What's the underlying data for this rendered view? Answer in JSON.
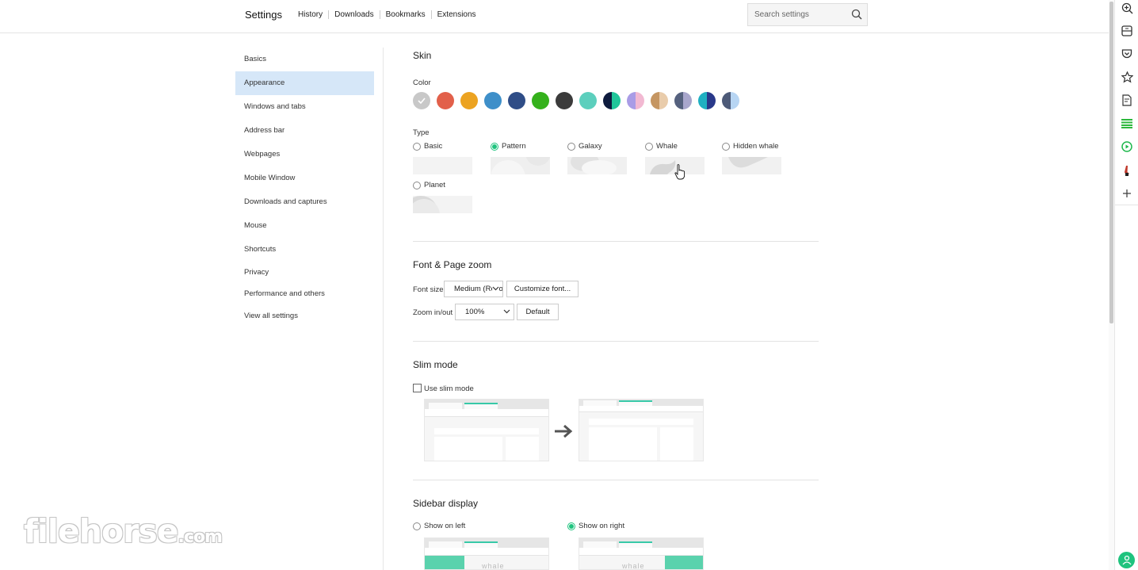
{
  "header": {
    "title": "Settings",
    "links": [
      "History",
      "Downloads",
      "Bookmarks",
      "Extensions"
    ],
    "search_placeholder": "Search settings"
  },
  "sidebar": {
    "items": [
      {
        "label": "Basics"
      },
      {
        "label": "Appearance",
        "active": true
      },
      {
        "label": "Windows and tabs"
      },
      {
        "label": "Address bar"
      },
      {
        "label": "Webpages"
      },
      {
        "label": "Mobile Window"
      },
      {
        "label": "Downloads and captures"
      },
      {
        "label": "Mouse"
      },
      {
        "label": "Shortcuts"
      },
      {
        "label": "Privacy"
      },
      {
        "label": "Performance and others"
      },
      {
        "label": "View all settings"
      }
    ]
  },
  "skin": {
    "title": "Skin",
    "color_label": "Color",
    "colors": [
      {
        "name": "gray",
        "colors": [
          "#c8c8c8"
        ],
        "selected": true
      },
      {
        "name": "red",
        "colors": [
          "#e2604a"
        ]
      },
      {
        "name": "orange",
        "colors": [
          "#eca321"
        ]
      },
      {
        "name": "blue",
        "colors": [
          "#3e8fc9"
        ]
      },
      {
        "name": "navy",
        "colors": [
          "#2f4d87"
        ]
      },
      {
        "name": "green",
        "colors": [
          "#35b11c"
        ]
      },
      {
        "name": "dark",
        "colors": [
          "#3b3b3b"
        ]
      },
      {
        "name": "teal",
        "colors": [
          "#5ccfbd"
        ]
      },
      {
        "name": "navy-mint",
        "colors": [
          "#0e1b3e",
          "#20c69a"
        ]
      },
      {
        "name": "lavender-pink",
        "colors": [
          "#a99ce6",
          "#f2b9d2"
        ]
      },
      {
        "name": "tan-beige",
        "colors": [
          "#c59662",
          "#e9ccab"
        ]
      },
      {
        "name": "slate-lilac",
        "colors": [
          "#55617e",
          "#a8a6cc"
        ]
      },
      {
        "name": "teal-indigo",
        "colors": [
          "#1fb0c2",
          "#29398a"
        ]
      },
      {
        "name": "slate-skyblue",
        "colors": [
          "#4d5a78",
          "#b7d5f3"
        ]
      }
    ],
    "type_label": "Type",
    "types": [
      {
        "label": "Basic",
        "selected": false
      },
      {
        "label": "Pattern",
        "selected": true
      },
      {
        "label": "Galaxy",
        "selected": false
      },
      {
        "label": "Whale",
        "selected": false
      },
      {
        "label": "Hidden whale",
        "selected": false
      },
      {
        "label": "Planet",
        "selected": false
      }
    ]
  },
  "font_zoom": {
    "title": "Font & Page zoom",
    "font_size_label": "Font size",
    "font_size_value": "Medium (Recommended)",
    "customize_font_label": "Customize font...",
    "zoom_label": "Zoom in/out",
    "zoom_value": "100%",
    "default_label": "Default"
  },
  "slim_mode": {
    "title": "Slim mode",
    "checkbox_label": "Use slim mode",
    "checked": false
  },
  "sidebar_display": {
    "title": "Sidebar display",
    "options": [
      {
        "label": "Show on left",
        "selected": false
      },
      {
        "label": "Show on right",
        "selected": true
      }
    ],
    "preview_text": "whale"
  },
  "right_toolbar": {
    "icons": [
      "zoom-icon",
      "capture-icon",
      "pocket-icon",
      "bookmark-star-icon",
      "notes-icon",
      "list-icon",
      "play-icon",
      "translate-icon",
      "add-icon",
      "assistant-icon"
    ]
  },
  "watermark": {
    "main": "filehorse",
    "suffix": ".com"
  },
  "colors": {
    "accent": "#1fc37e",
    "nav_active": "#d6e7f8"
  }
}
